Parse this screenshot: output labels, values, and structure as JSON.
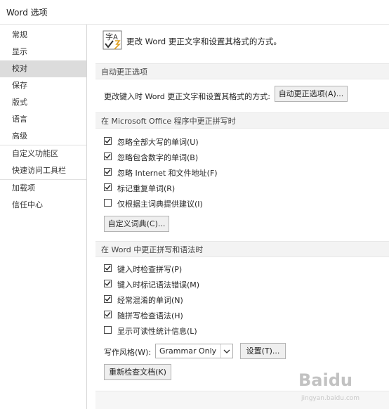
{
  "window": {
    "title": "Word 选项"
  },
  "sidebar": {
    "items": [
      {
        "label": "常规"
      },
      {
        "label": "显示"
      },
      {
        "label": "校对"
      },
      {
        "label": "保存"
      },
      {
        "label": "版式"
      },
      {
        "label": "语言"
      },
      {
        "label": "高级"
      },
      {
        "label": "自定义功能区"
      },
      {
        "label": "快速访问工具栏"
      },
      {
        "label": "加载项"
      },
      {
        "label": "信任中心"
      }
    ],
    "selected": "校对"
  },
  "main": {
    "intro": "更改 Word 更正文字和设置其格式的方式。",
    "autocorrect": {
      "header": "自动更正选项",
      "label": "更改键入时 Word 更正文字和设置其格式的方式:",
      "button": "自动更正选项(A)..."
    },
    "office": {
      "header": "在 Microsoft Office 程序中更正拼写时",
      "options": [
        {
          "label": "忽略全部大写的单词(U)",
          "checked": true
        },
        {
          "label": "忽略包含数字的单词(B)",
          "checked": true
        },
        {
          "label": "忽略 Internet 和文件地址(F)",
          "checked": true
        },
        {
          "label": "标记重复单词(R)",
          "checked": true
        },
        {
          "label": "仅根据主词典提供建议(I)",
          "checked": false
        }
      ],
      "dict_button": "自定义词典(C)..."
    },
    "word": {
      "header": "在 Word 中更正拼写和语法时",
      "options": [
        {
          "label": "键入时检查拼写(P)",
          "checked": true
        },
        {
          "label": "键入时标记语法错误(M)",
          "checked": true
        },
        {
          "label": "经常混淆的单词(N)",
          "checked": true
        },
        {
          "label": "随拼写检查语法(H)",
          "checked": true
        },
        {
          "label": "显示可读性统计信息(L)",
          "checked": false
        }
      ],
      "style_label": "写作风格(W):",
      "style_value": "Grammar Only",
      "settings_button": "设置(T)...",
      "recheck_button": "重新检查文档(K)"
    }
  },
  "watermark": {
    "big": "Baidu",
    "small": "jingyan.baidu.com"
  }
}
